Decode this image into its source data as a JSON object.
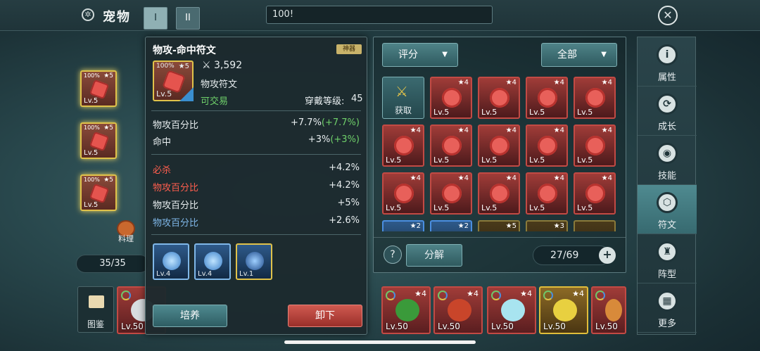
{
  "header": {
    "title": "宠物",
    "tab1": "I",
    "tab2": "II",
    "chat_text": "100!"
  },
  "left": {
    "slots": [
      {
        "pct": "100%",
        "stars": "★5",
        "lv": "Lv.5"
      },
      {
        "pct": "100%",
        "stars": "★5",
        "lv": "Lv.5"
      },
      {
        "pct": "100%",
        "stars": "★5",
        "lv": "Lv.5"
      }
    ],
    "cook_label": "料理",
    "count": "35/35"
  },
  "popup": {
    "title": "物攻-命中符文",
    "badge": "神器",
    "icon": {
      "pct": "100%",
      "stars": "★5",
      "lv": "Lv.5"
    },
    "power": "3,592",
    "rune_type": "物攻符文",
    "tradable": "可交易",
    "req_label": "穿戴等级:",
    "req_value": "45",
    "main_stats": [
      {
        "name": "物攻百分比",
        "value": "+7.7%",
        "bonus": "(+7.7%)"
      },
      {
        "name": "命中",
        "value": "+3%",
        "bonus": "(+3%)"
      }
    ],
    "sub_stats": [
      {
        "name": "必杀",
        "value": "+4.2%",
        "color": "#ff5e4e"
      },
      {
        "name": "物攻百分比",
        "value": "+4.2%",
        "color": "#ff5e4e"
      },
      {
        "name": "物攻百分比",
        "value": "+5%",
        "color": "#ffffff"
      },
      {
        "name": "物攻百分比",
        "value": "+2.6%",
        "color": "#7fb7e8"
      }
    ],
    "skills": [
      {
        "lv": "Lv.4"
      },
      {
        "lv": "Lv.4"
      },
      {
        "lv": "Lv.1"
      }
    ],
    "btn_cultivate": "培养",
    "btn_unload": "卸下"
  },
  "panel": {
    "sort_label": "评分",
    "filter_label": "全部",
    "get_label": "获取",
    "rune_cells": [
      {
        "stars": "★4",
        "lv": "Lv.5"
      },
      {
        "stars": "★4",
        "lv": "Lv.5"
      },
      {
        "stars": "★4",
        "lv": "Lv.5"
      },
      {
        "stars": "★4",
        "lv": "Lv.5"
      },
      {
        "stars": "★4",
        "lv": "Lv.5"
      },
      {
        "stars": "★4",
        "lv": "Lv.5"
      },
      {
        "stars": "★4",
        "lv": "Lv.5"
      },
      {
        "stars": "★4",
        "lv": "Lv.5"
      },
      {
        "stars": "★4",
        "lv": "Lv.5"
      },
      {
        "stars": "★4",
        "lv": "Lv.5"
      },
      {
        "stars": "★4",
        "lv": "Lv.5"
      },
      {
        "stars": "★4",
        "lv": "Lv.5"
      },
      {
        "stars": "★4",
        "lv": "Lv.5"
      },
      {
        "stars": "★4",
        "lv": "Lv.5"
      }
    ],
    "partial_row": [
      "★2",
      "★2",
      "★5",
      "★3",
      ""
    ],
    "help": "?",
    "decompose": "分解",
    "capacity": "27/69",
    "plus": "+"
  },
  "sidebar": {
    "items": [
      {
        "label": "属性",
        "icon": "i"
      },
      {
        "label": "成长",
        "icon": "⟳"
      },
      {
        "label": "技能",
        "icon": "◉"
      },
      {
        "label": "符文",
        "icon": "⬡"
      },
      {
        "label": "阵型",
        "icon": "♜"
      },
      {
        "label": "更多",
        "icon": "▦"
      }
    ]
  },
  "bottom": {
    "atlas_label": "图鉴",
    "pets": [
      {
        "lv": "Lv.50",
        "stars": "★4"
      },
      {
        "lv": "Lv.50",
        "stars": "★4"
      },
      {
        "lv": "Lv.50",
        "stars": "★4"
      },
      {
        "lv": "Lv.50",
        "stars": "★4"
      },
      {
        "lv": "Lv.50",
        "stars": "★4"
      },
      {
        "lv": "Lv.50",
        "stars": "★4"
      }
    ]
  },
  "colors": {
    "accent": "#4f8a90",
    "gold": "#e0c24a",
    "rune_red": "#c24a44",
    "green": "#6fd06a"
  }
}
